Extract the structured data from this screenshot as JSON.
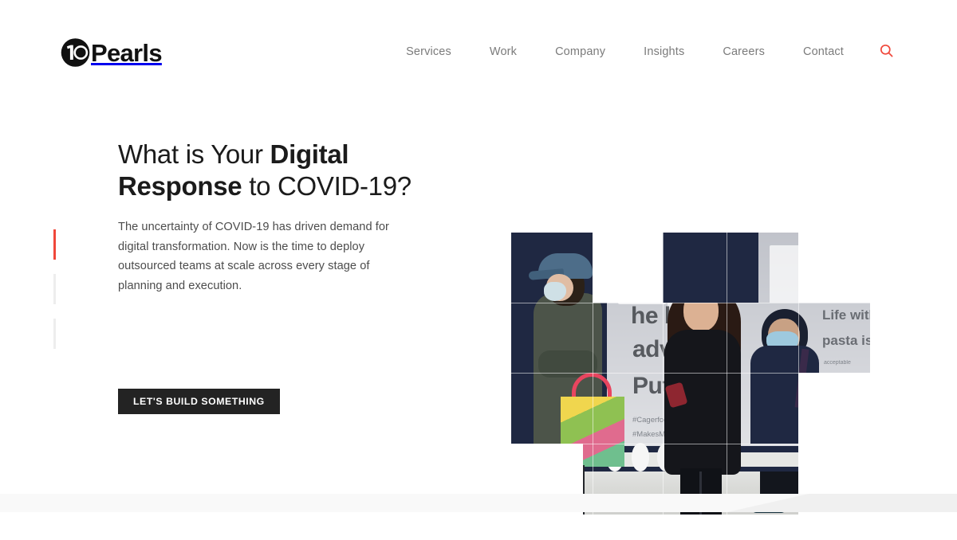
{
  "brand": {
    "mark_icon": "tenpearls-circle-logo",
    "mark_text": "10",
    "word": "Pearls"
  },
  "nav": {
    "items": [
      {
        "label": "Services"
      },
      {
        "label": "Work"
      },
      {
        "label": "Company"
      },
      {
        "label": "Insights"
      },
      {
        "label": "Careers"
      },
      {
        "label": "Contact"
      }
    ],
    "search_icon": "search-icon",
    "search_color": "#f0473a"
  },
  "hero": {
    "title_lead": "What is Your ",
    "title_strong_1": "Digital",
    "title_mid": " ",
    "title_strong_2": "Response",
    "title_tail": " to COVID-19?",
    "body": "The uncertainty of COVID-19 has driven demand for digital transformation. Now is the time to deploy outsourced teams at scale across every stage of planning and execution.",
    "cta_label": "LET'S BUILD SOMETHING",
    "cta_background": "#232323",
    "slider": {
      "active_index": 0,
      "active_color": "#f0473a",
      "inactive_color": "#ededed",
      "bars": [
        {
          "state": "active"
        },
        {
          "state": "inactive"
        },
        {
          "state": "inactive"
        }
      ]
    }
  },
  "collage": {
    "alt": "Three masked pedestrians walking past a storefront billboard",
    "billboard_text": {
      "line1": "he best",
      "line2": "advic",
      "line3": "Put a",
      "line4": "Life without",
      "line5": "pasta is not",
      "line6": "acceptable",
      "hashtag1": "#Cagerfoo",
      "hashtag2": "#MakesMeWhole"
    }
  },
  "footer_band": {
    "band_color": "#f9f9f9",
    "wedge_color": "#f0f0f0"
  }
}
